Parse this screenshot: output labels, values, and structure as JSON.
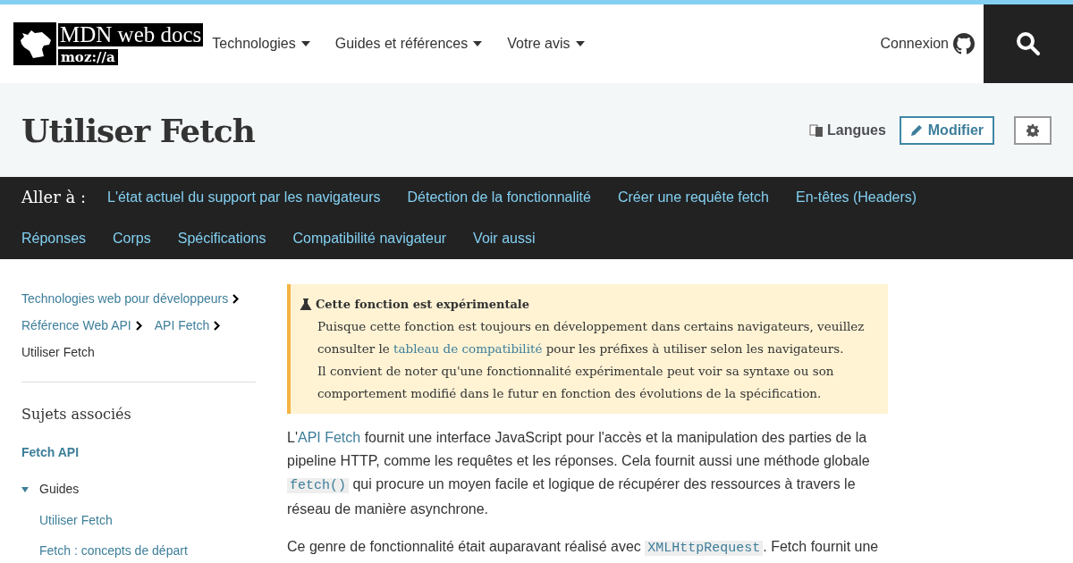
{
  "logo": {
    "wordmark": "MDN web docs",
    "org": "moz://a"
  },
  "nav": [
    {
      "label": "Technologies"
    },
    {
      "label": "Guides et références"
    },
    {
      "label": "Votre avis"
    }
  ],
  "login": "Connexion",
  "title": "Utiliser Fetch",
  "actions": {
    "languages": "Langues",
    "edit": "Modifier"
  },
  "jump": {
    "label": "Aller à :",
    "links": [
      "L'état actuel du support par les navigateurs",
      "Détection de la fonctionnalité",
      "Créer une requête fetch",
      "En-têtes (Headers)",
      "Réponses",
      "Corps",
      "Spécifications",
      "Compatibilité navigateur",
      "Voir aussi"
    ]
  },
  "breadcrumbs": [
    {
      "label": "Technologies web pour développeurs",
      "link": true
    },
    {
      "label": "Référence Web API",
      "link": true
    },
    {
      "label": "API Fetch",
      "link": true
    },
    {
      "label": "Utiliser Fetch",
      "link": false
    }
  ],
  "sidebar": {
    "heading": "Sujets associés",
    "section": "Fetch API",
    "groups": [
      {
        "label": "Guides",
        "expanded": true,
        "children": [
          {
            "label": "Utiliser Fetch"
          },
          {
            "label": "Fetch : concepts de départ"
          }
        ]
      }
    ]
  },
  "notice": {
    "title": "Cette fonction est expérimentale",
    "paragraphs": [
      [
        {
          "kind": "text",
          "text": "Puisque cette fonction est toujours en développement dans certains navigateurs, veuillez consulter le "
        },
        {
          "kind": "link",
          "text": "tableau de compatibilité"
        },
        {
          "kind": "text",
          "text": " pour les préfixes à utiliser selon les navigateurs."
        }
      ],
      [
        {
          "kind": "text",
          "text": "Il convient de noter qu'une fonctionnalité expérimentale peut voir sa syntaxe ou son comportement modifié dans le futur en fonction des évolutions de la spécification."
        }
      ]
    ]
  },
  "paragraphs": [
    [
      {
        "kind": "text",
        "text": "L'"
      },
      {
        "kind": "link",
        "text": "API Fetch"
      },
      {
        "kind": "text",
        "text": " fournit une interface JavaScript pour l'accès et la manipulation des parties de la pipeline HTTP, comme les requêtes et les réponses. Cela fournit aussi une méthode globale "
      },
      {
        "kind": "code",
        "text": "fetch()"
      },
      {
        "kind": "text",
        "text": " qui procure un moyen facile et logique de récupérer des ressources à travers le réseau de manière asynchrone."
      }
    ],
    [
      {
        "kind": "text",
        "text": "Ce genre de fonctionnalité était auparavant réalisé avec "
      },
      {
        "kind": "code",
        "text": "XMLHttpRequest"
      },
      {
        "kind": "text",
        "text": ". Fetch fournit une"
      }
    ]
  ]
}
